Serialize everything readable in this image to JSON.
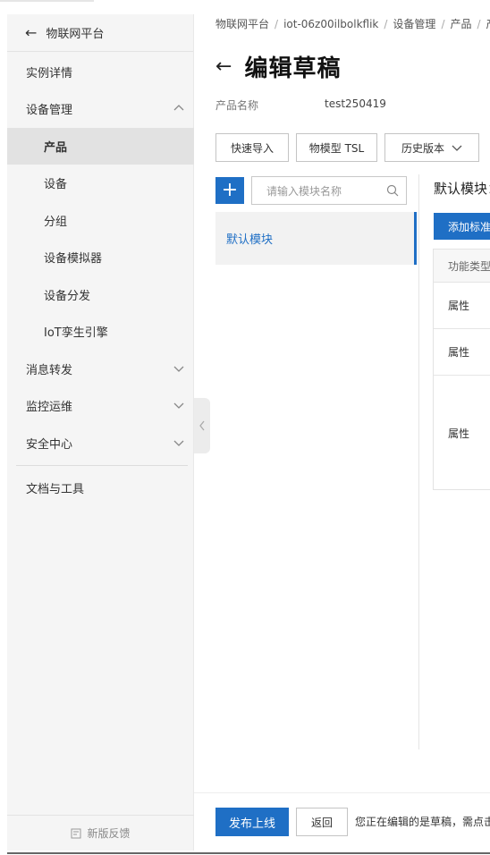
{
  "sidebar": {
    "back_label": "物联网平台",
    "items": [
      {
        "label": "实例详情"
      },
      {
        "label": "设备管理"
      },
      {
        "label": "产品"
      },
      {
        "label": "设备"
      },
      {
        "label": "分组"
      },
      {
        "label": "设备模拟器"
      },
      {
        "label": "设备分发"
      },
      {
        "label": "IoT孪生引擎"
      },
      {
        "label": "消息转发"
      },
      {
        "label": "监控运维"
      },
      {
        "label": "安全中心"
      },
      {
        "label": "文档与工具"
      }
    ],
    "feedback_label": "新版反馈"
  },
  "breadcrumb": [
    "物联网平台",
    "iot-06z00ilbolkflik",
    "设备管理",
    "产品",
    "产"
  ],
  "header": {
    "title": "编辑草稿",
    "product_name_label": "产品名称",
    "product_name_value": "test250419"
  },
  "toolbar": {
    "quick_import": "快速导入",
    "tsl": "物模型 TSL",
    "history": "历史版本"
  },
  "module_panel": {
    "add_icon": "+",
    "search_placeholder": "请输入模块名称",
    "modules": [
      {
        "label": "默认模块"
      }
    ]
  },
  "detail": {
    "title": "默认模块：",
    "add_standard": "添加标准功能",
    "table": {
      "header": "功能类型",
      "rows": [
        "属性",
        "属性",
        "属性"
      ]
    }
  },
  "footer": {
    "publish": "发布上线",
    "back": "返回",
    "notice": "您正在编辑的是草稿，需点击"
  },
  "colors": {
    "accent": "#1f6fc5",
    "sidebar_bg": "#f5f5f5",
    "active_bg": "#e2e2e2"
  }
}
